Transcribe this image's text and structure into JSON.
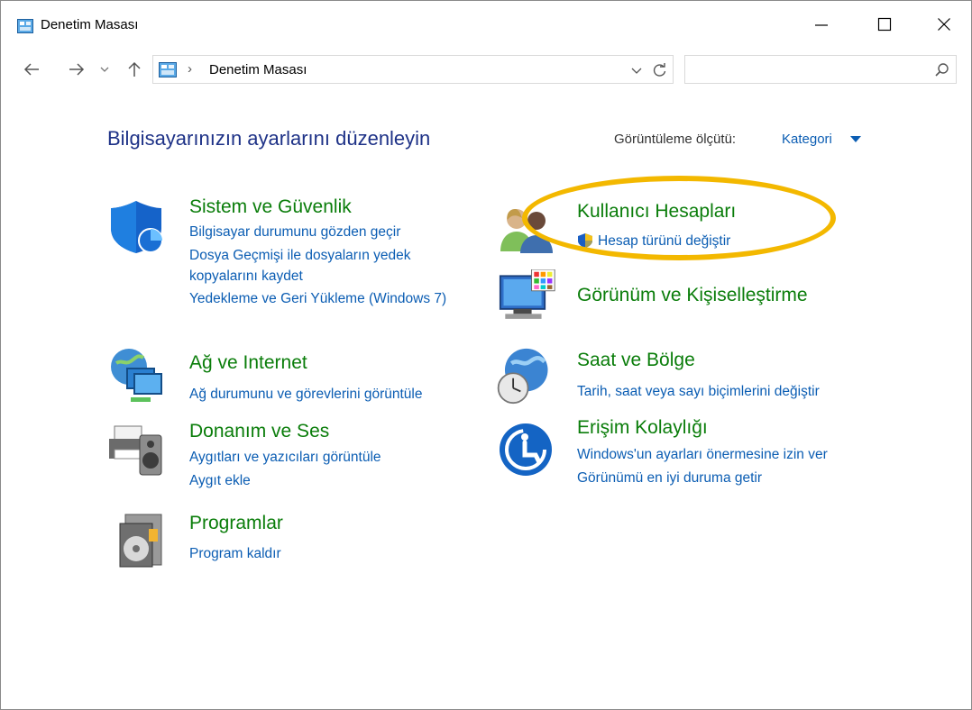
{
  "window": {
    "title": "Denetim Masası",
    "controls": {
      "minimize": "—",
      "maximize": "☐",
      "close": "✕"
    }
  },
  "address_bar": {
    "separator": "›",
    "breadcrumb": "Denetim Masası",
    "search_placeholder": ""
  },
  "main": {
    "page_title": "Bilgisayarınızın ayarlarını düzenleyin",
    "view_by_label": "Görüntüleme ölçütü:",
    "view_by_value": "Kategori",
    "categories": [
      {
        "icon": "shield-icon",
        "title": "Sistem ve Güvenlik",
        "links": [
          "Bilgisayar durumunu gözden geçir",
          "Dosya Geçmişi ile dosyaların yedek kopyalarını kaydet",
          "Yedekleme ve Geri Yükleme (Windows 7)"
        ]
      },
      {
        "icon": "network-icon",
        "title": "Ağ ve Internet",
        "links": [
          "Ağ durumunu ve görevlerini görüntüle"
        ]
      },
      {
        "icon": "printer-speaker-icon",
        "title": "Donanım ve Ses",
        "links": [
          "Aygıtları ve yazıcıları görüntüle",
          "Aygıt ekle"
        ]
      },
      {
        "icon": "programs-icon",
        "title": "Programlar",
        "links": [
          "Program kaldır"
        ]
      },
      {
        "icon": "users-icon",
        "title": "Kullanıcı Hesapları",
        "links": [
          "Hesap türünü değiştir"
        ]
      },
      {
        "icon": "monitor-color-icon",
        "title": "Görünüm ve Kişiselleştirme",
        "links": []
      },
      {
        "icon": "globe-clock-icon",
        "title": "Saat ve Bölge",
        "links": [
          "Tarih, saat veya sayı biçimlerini değiştir"
        ]
      },
      {
        "icon": "ease-of-access-icon",
        "title": "Erişim Kolaylığı",
        "links": [
          "Windows'un ayarları önermesine izin ver",
          "Görünümü en iyi duruma getir"
        ]
      }
    ]
  },
  "colors": {
    "title_blue": "#1e3287",
    "category_green": "#0a7d0a",
    "link_blue": "#0b5db3",
    "highlight_ellipse": "#f3b800"
  }
}
